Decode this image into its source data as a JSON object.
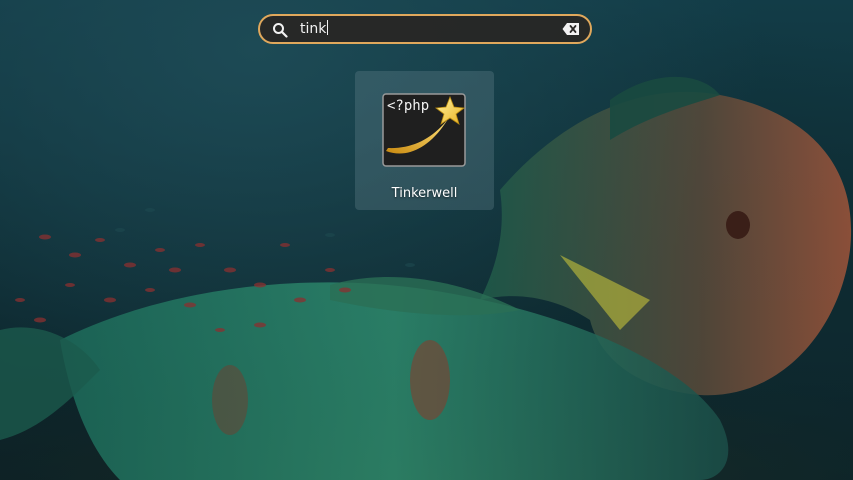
{
  "search": {
    "query": "tink",
    "icon": "search-icon",
    "clear_icon": "clear-text-icon",
    "accent_color": "#e0a85c"
  },
  "results": [
    {
      "name": "Tinkerwell",
      "icon": "tinkerwell-app-icon",
      "icon_text": "<?php"
    }
  ],
  "wallpaper": {
    "description_colors": [
      "#123c47",
      "#0f2f37",
      "#0b2026"
    ]
  }
}
